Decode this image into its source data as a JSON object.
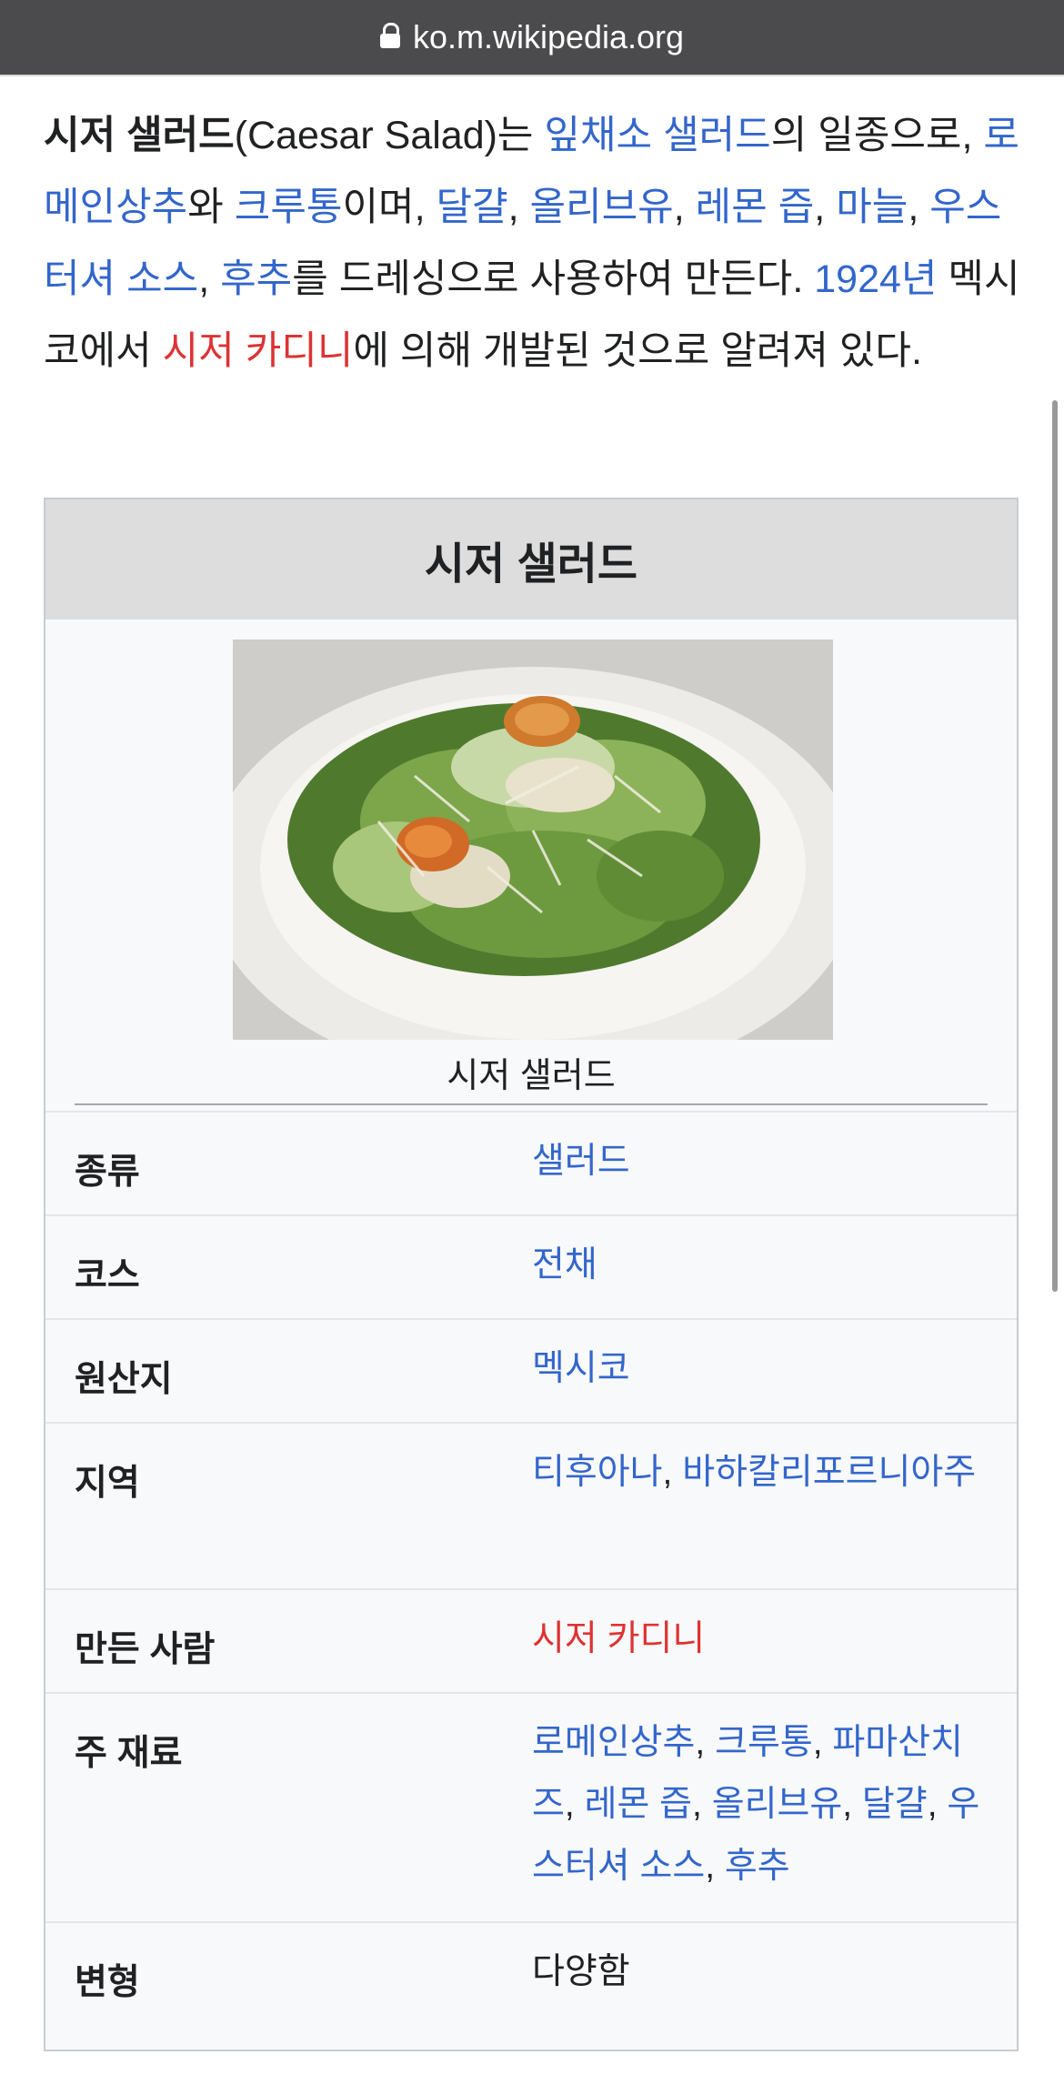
{
  "browser": {
    "url": "ko.m.wikipedia.org"
  },
  "intro": {
    "title_bold": "시저 샐러드",
    "p1": "(Caesar Salad)는 ",
    "link_leaf_salad": "잎채소 샐러드",
    "p2": "의 일종으로, ",
    "link_romaine": "로메인상추",
    "p3": "와 ",
    "link_crouton": "크루통",
    "p4": "이며, ",
    "link_egg": "달걀",
    "sep1": ", ",
    "link_olive": "올리브유",
    "sep2": ", ",
    "link_lemon": "레몬 즙",
    "sep3": ", ",
    "link_garlic": "마늘",
    "sep4": ", ",
    "link_worcester": "우스터셔 소스",
    "sep5": ", ",
    "link_pepper": "후추",
    "p5": "를 드레싱으로 사용하여 만든다. ",
    "link_year": "1924년",
    "p6": " 멕시코에서 ",
    "link_cardini": "시저 카디니",
    "p7": "에 의해 개발된 것으로 알려져 있다."
  },
  "infobox": {
    "title": "시저 샐러드",
    "image_caption": "시저 샐러드",
    "rows": [
      {
        "label": "종류",
        "value": "샐러드"
      },
      {
        "label": "코스",
        "value": "전채"
      },
      {
        "label": "원산지",
        "value": "멕시코"
      },
      {
        "label": "지역",
        "value_a": "티후아나",
        "sep": ", ",
        "value_b": "바하칼리포르니아주"
      },
      {
        "label": "만든 사람",
        "value": "시저 카디니"
      },
      {
        "label": "주 재료",
        "items": [
          "로메인상추",
          "크루통",
          "파마산치즈",
          "레몬 즙",
          "올리브유",
          "달걀",
          "우스터셔 소스",
          "후추"
        ],
        "sep": ", "
      },
      {
        "label": "변형",
        "value": "다양함"
      }
    ]
  },
  "colors": {
    "link": "#3366cc",
    "redlink": "#dd3333",
    "text": "#202122",
    "infobox_title_bg": "#dddddd"
  },
  "icons": [
    "lock-icon"
  ]
}
